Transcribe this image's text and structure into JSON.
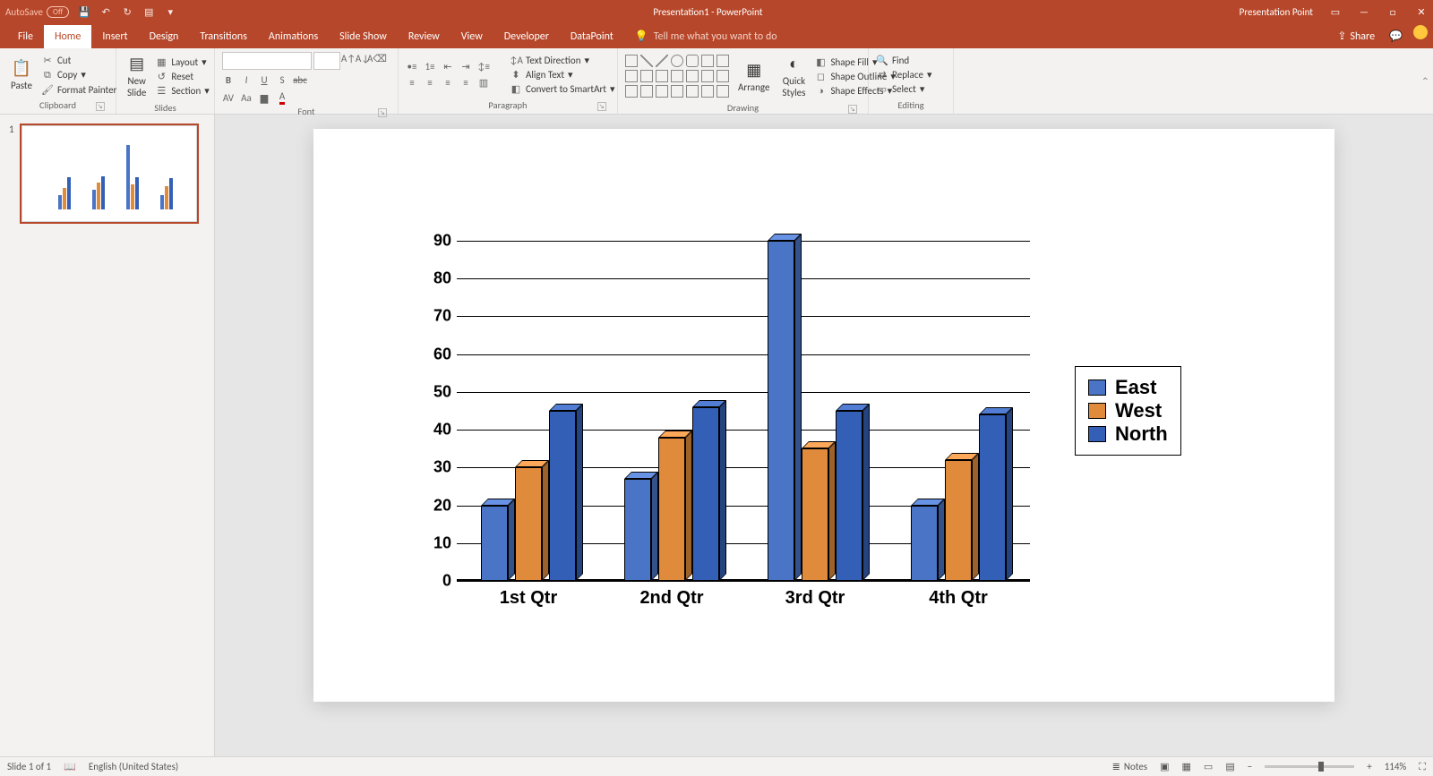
{
  "titlebar": {
    "autosave_label": "AutoSave",
    "autosave_state": "Off",
    "document_title": "Presentation1 - PowerPoint",
    "presentation_point": "Presentation Point"
  },
  "tabs": {
    "items": [
      "File",
      "Home",
      "Insert",
      "Design",
      "Transitions",
      "Animations",
      "Slide Show",
      "Review",
      "View",
      "Developer",
      "DataPoint"
    ],
    "active_index": 1,
    "tell_me": "Tell me what you want to do",
    "share": "Share"
  },
  "ribbon": {
    "clipboard": {
      "label": "Clipboard",
      "paste": "Paste",
      "cut": "Cut",
      "copy": "Copy",
      "format_painter": "Format Painter"
    },
    "slides": {
      "label": "Slides",
      "new_slide": "New\nSlide",
      "layout": "Layout",
      "reset": "Reset",
      "section": "Section"
    },
    "font": {
      "label": "Font",
      "family": "",
      "size": ""
    },
    "paragraph": {
      "label": "Paragraph",
      "text_direction": "Text Direction",
      "align_text": "Align Text",
      "convert_smartart": "Convert to SmartArt"
    },
    "drawing": {
      "label": "Drawing",
      "arrange": "Arrange",
      "quick_styles": "Quick\nStyles",
      "shape_fill": "Shape Fill",
      "shape_outline": "Shape Outline",
      "shape_effects": "Shape Effects"
    },
    "editing": {
      "label": "Editing",
      "find": "Find",
      "replace": "Replace",
      "select": "Select"
    }
  },
  "thumbs": {
    "slide1_number": "1"
  },
  "statusbar": {
    "slide_pos": "Slide 1 of 1",
    "language": "English (United States)",
    "notes": "Notes",
    "zoom": "114%"
  },
  "chart_data": {
    "type": "bar",
    "categories": [
      "1st Qtr",
      "2nd Qtr",
      "3rd Qtr",
      "4th Qtr"
    ],
    "series": [
      {
        "name": "East",
        "color": "#4a74c5",
        "values": [
          20,
          27,
          90,
          20
        ]
      },
      {
        "name": "West",
        "color": "#e08a3c",
        "values": [
          30,
          38,
          35,
          32
        ]
      },
      {
        "name": "North",
        "color": "#3360b6",
        "values": [
          45,
          46,
          45,
          44
        ]
      }
    ],
    "ylim": [
      0,
      90
    ],
    "yticks": [
      0,
      10,
      20,
      30,
      40,
      50,
      60,
      70,
      80,
      90
    ],
    "title": "",
    "xlabel": "",
    "ylabel": ""
  }
}
